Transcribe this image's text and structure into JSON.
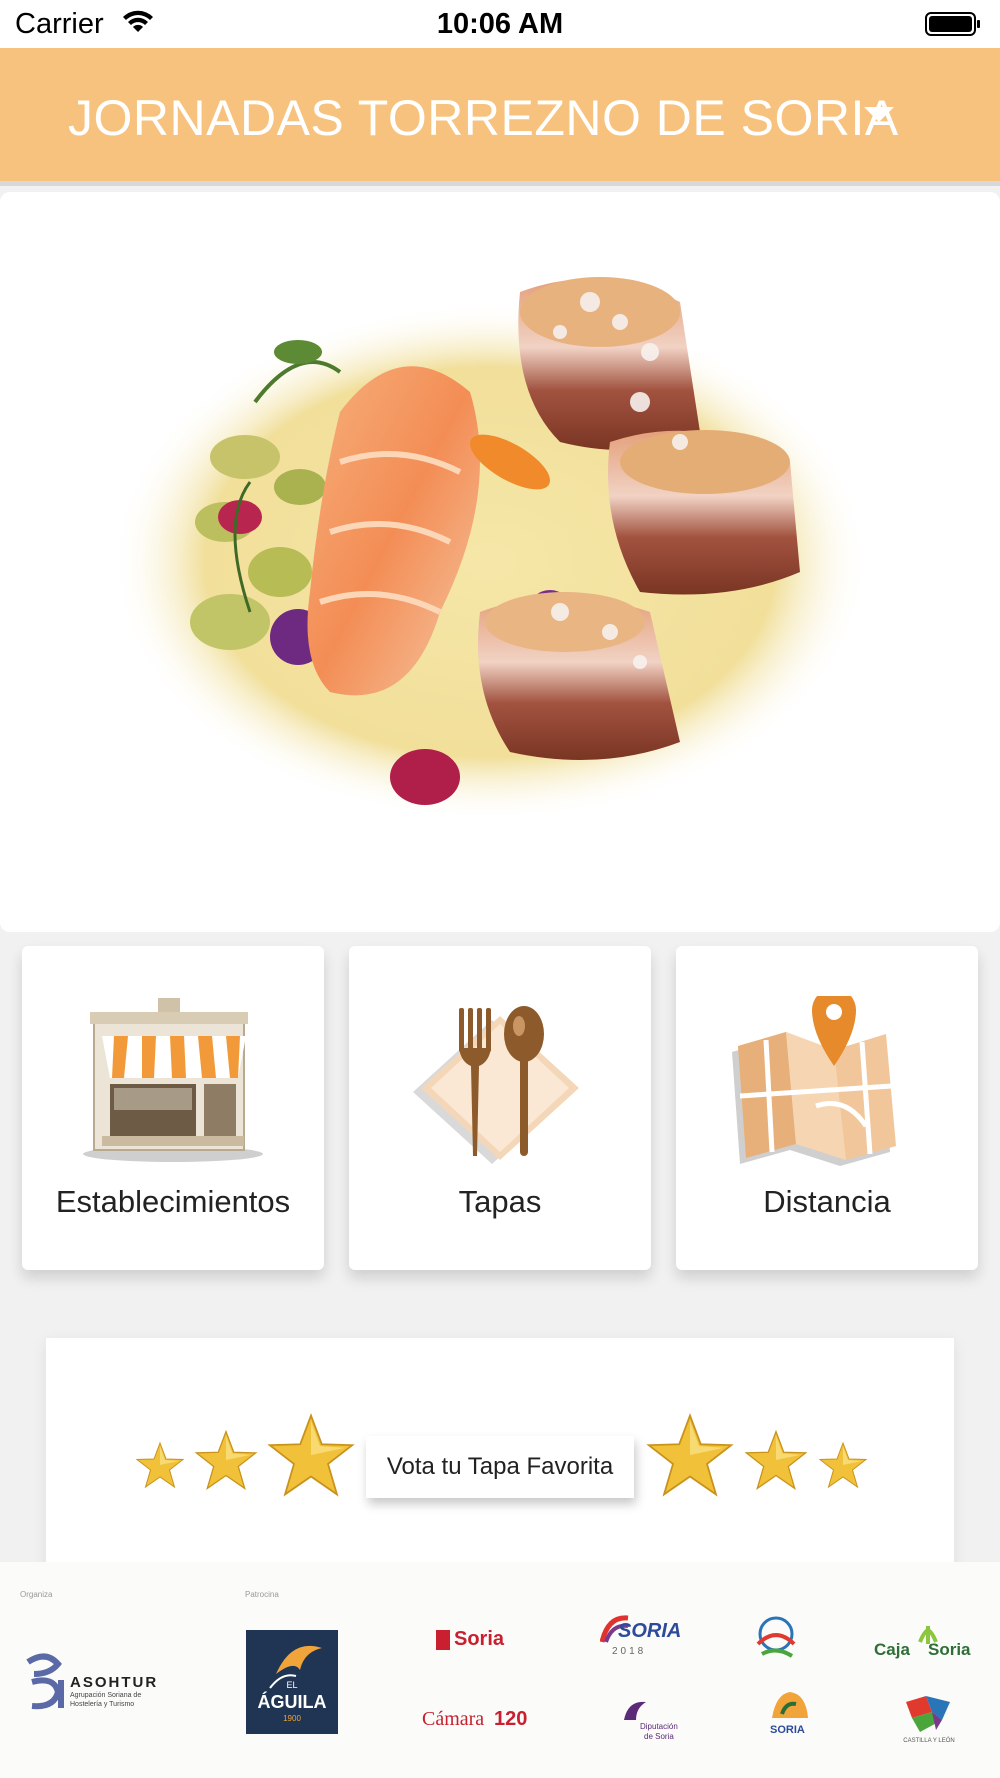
{
  "status_bar": {
    "carrier": "Carrier",
    "time": "10:06 AM",
    "icons": [
      "wifi-icon",
      "battery-icon"
    ]
  },
  "header": {
    "title": "JORNADAS TORREZNO DE SORIA",
    "caret_icon": "caret-down-icon",
    "background": "#f7c27d"
  },
  "hero": {
    "image": "dish-photo"
  },
  "menu": {
    "tiles": [
      {
        "label": "Establecimientos",
        "icon": "storefront-icon"
      },
      {
        "label": "Tapas",
        "icon": "fork-spoon-icon"
      },
      {
        "label": "Distancia",
        "icon": "map-pin-icon"
      }
    ]
  },
  "vote": {
    "label": "Vota tu Tapa Favorita",
    "icon": "star-icon"
  },
  "sponsors": {
    "organiza": "Organiza",
    "patrocina": "Patrocina",
    "asohtur_name": "ASOHTUR",
    "asohtur_sub1": "Agrupación Soriana de",
    "asohtur_sub2": "Hostelería y Turismo",
    "aguila_top": "EL",
    "aguila_name": "ÁGUILA",
    "aguila_year": "1900",
    "soria_ayto": "Soria",
    "soria_2018": "SORIA",
    "soria_2018_sub": "2018",
    "caja": "Caja",
    "caja_soria": "Soria",
    "camara": "Cámara",
    "camara_num": "120",
    "diputacion_1": "Diputación",
    "diputacion_2": "de Soria",
    "soria_ni_te_la": "SORIA",
    "castilla": "CASTILLA Y LEÓN"
  },
  "colors": {
    "accent": "#f7c27d",
    "star_gold": "#f2c13a",
    "text": "#222222"
  }
}
